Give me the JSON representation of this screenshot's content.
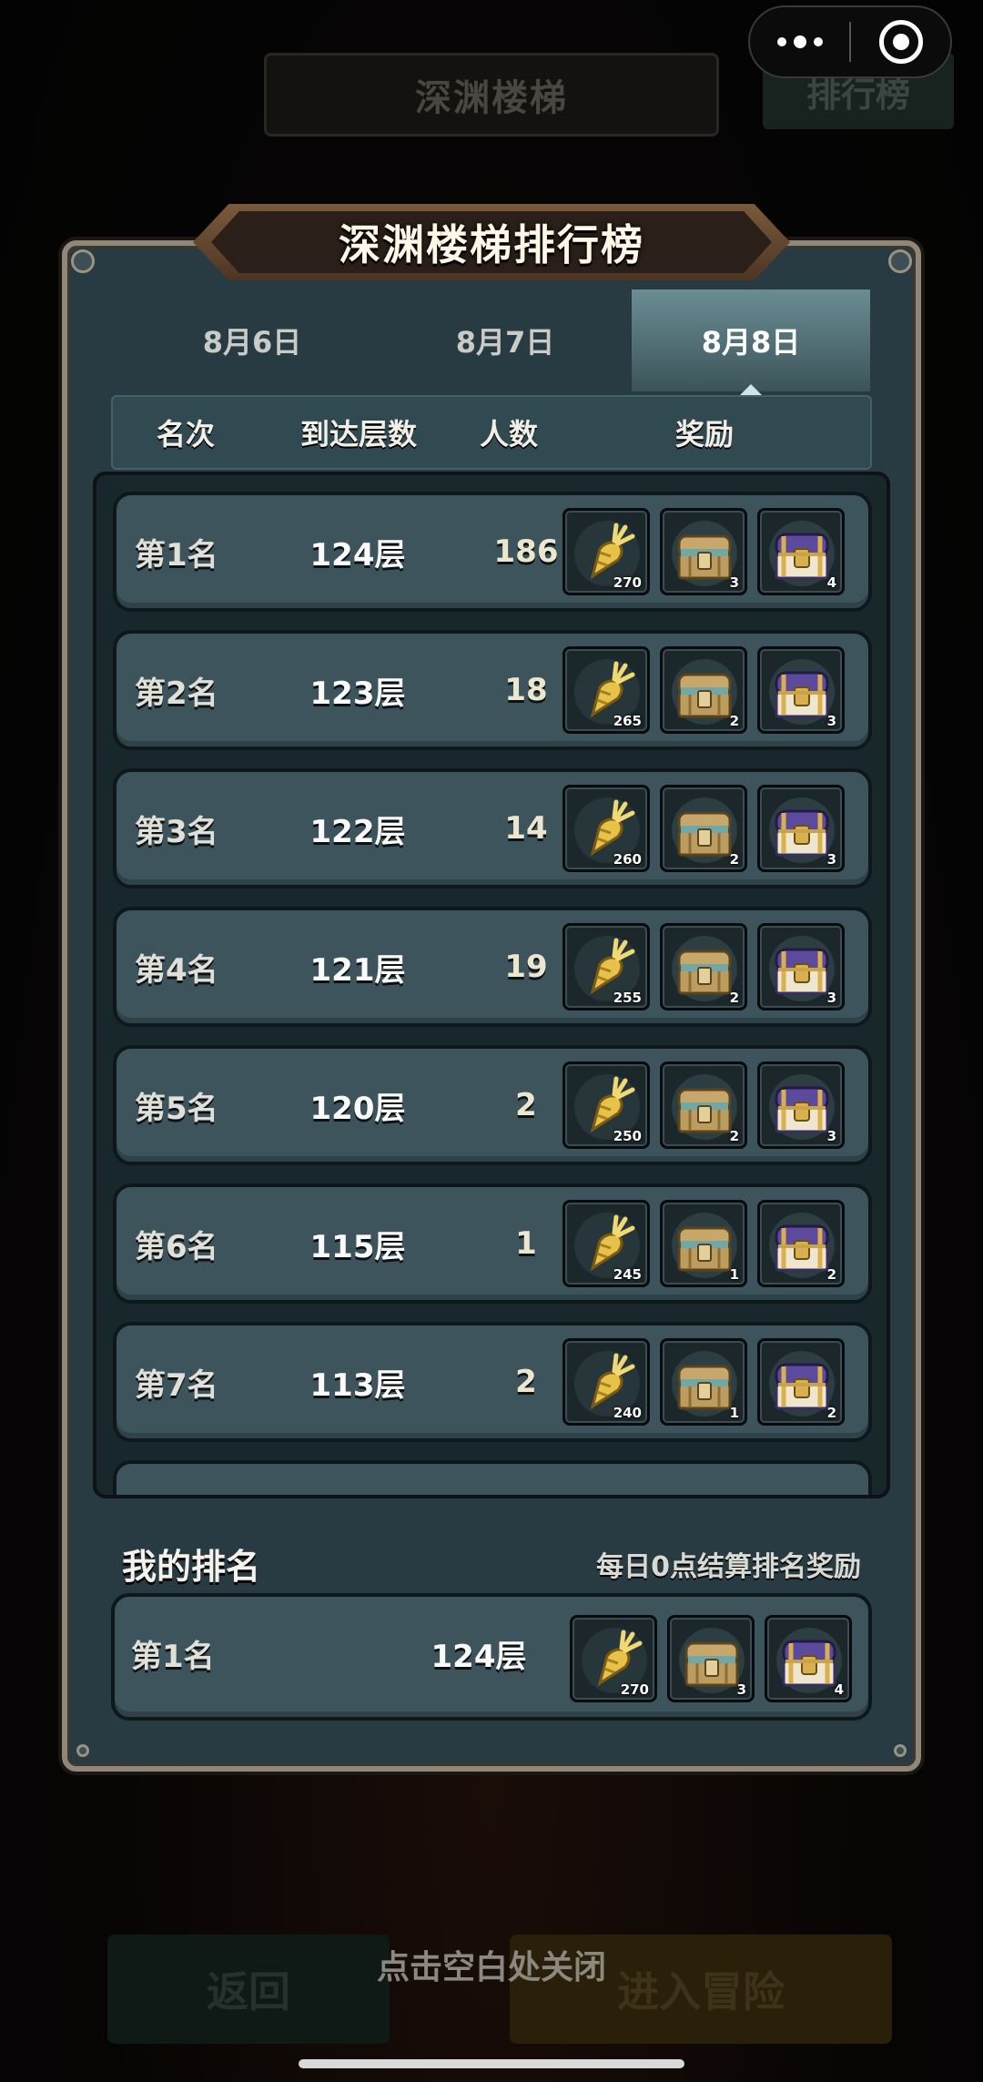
{
  "background": {
    "title": "深渊楼梯",
    "rank_button": "排行榜",
    "back_button": "返回",
    "enter_button": "进入冒险"
  },
  "panel": {
    "title": "深渊楼梯排行榜",
    "tabs": [
      "8月6日",
      "8月7日",
      "8月8日"
    ],
    "active_tab": "8月8日",
    "headers": {
      "rank": "名次",
      "floor": "到达层数",
      "count": "人数",
      "reward": "奖励"
    },
    "rows": [
      {
        "rank": "第1名",
        "floor": "124层",
        "count": "186",
        "rewards": [
          "270",
          "3",
          "4"
        ]
      },
      {
        "rank": "第2名",
        "floor": "123层",
        "count": "18",
        "rewards": [
          "265",
          "2",
          "3"
        ]
      },
      {
        "rank": "第3名",
        "floor": "122层",
        "count": "14",
        "rewards": [
          "260",
          "2",
          "3"
        ]
      },
      {
        "rank": "第4名",
        "floor": "121层",
        "count": "19",
        "rewards": [
          "255",
          "2",
          "3"
        ]
      },
      {
        "rank": "第5名",
        "floor": "120层",
        "count": "2",
        "rewards": [
          "250",
          "2",
          "3"
        ]
      },
      {
        "rank": "第6名",
        "floor": "115层",
        "count": "1",
        "rewards": [
          "245",
          "1",
          "2"
        ]
      },
      {
        "rank": "第7名",
        "floor": "113层",
        "count": "2",
        "rewards": [
          "240",
          "1",
          "2"
        ]
      }
    ],
    "reward_icons": [
      "golden-carrot-icon",
      "silver-chest-icon",
      "purple-chest-icon"
    ],
    "my_rank": {
      "title": "我的排名",
      "settle_note": "每日0点结算排名奖励",
      "rank": "第1名",
      "floor": "124层",
      "rewards": [
        "270",
        "3",
        "4"
      ]
    }
  },
  "close_hint": "点击空白处关闭",
  "colors": {
    "panel_bg": "#283a42",
    "row_bg": "#3d545c",
    "active_tab": "#5a7a80",
    "frame": "#8f8878",
    "banner": "#6a4a30"
  }
}
